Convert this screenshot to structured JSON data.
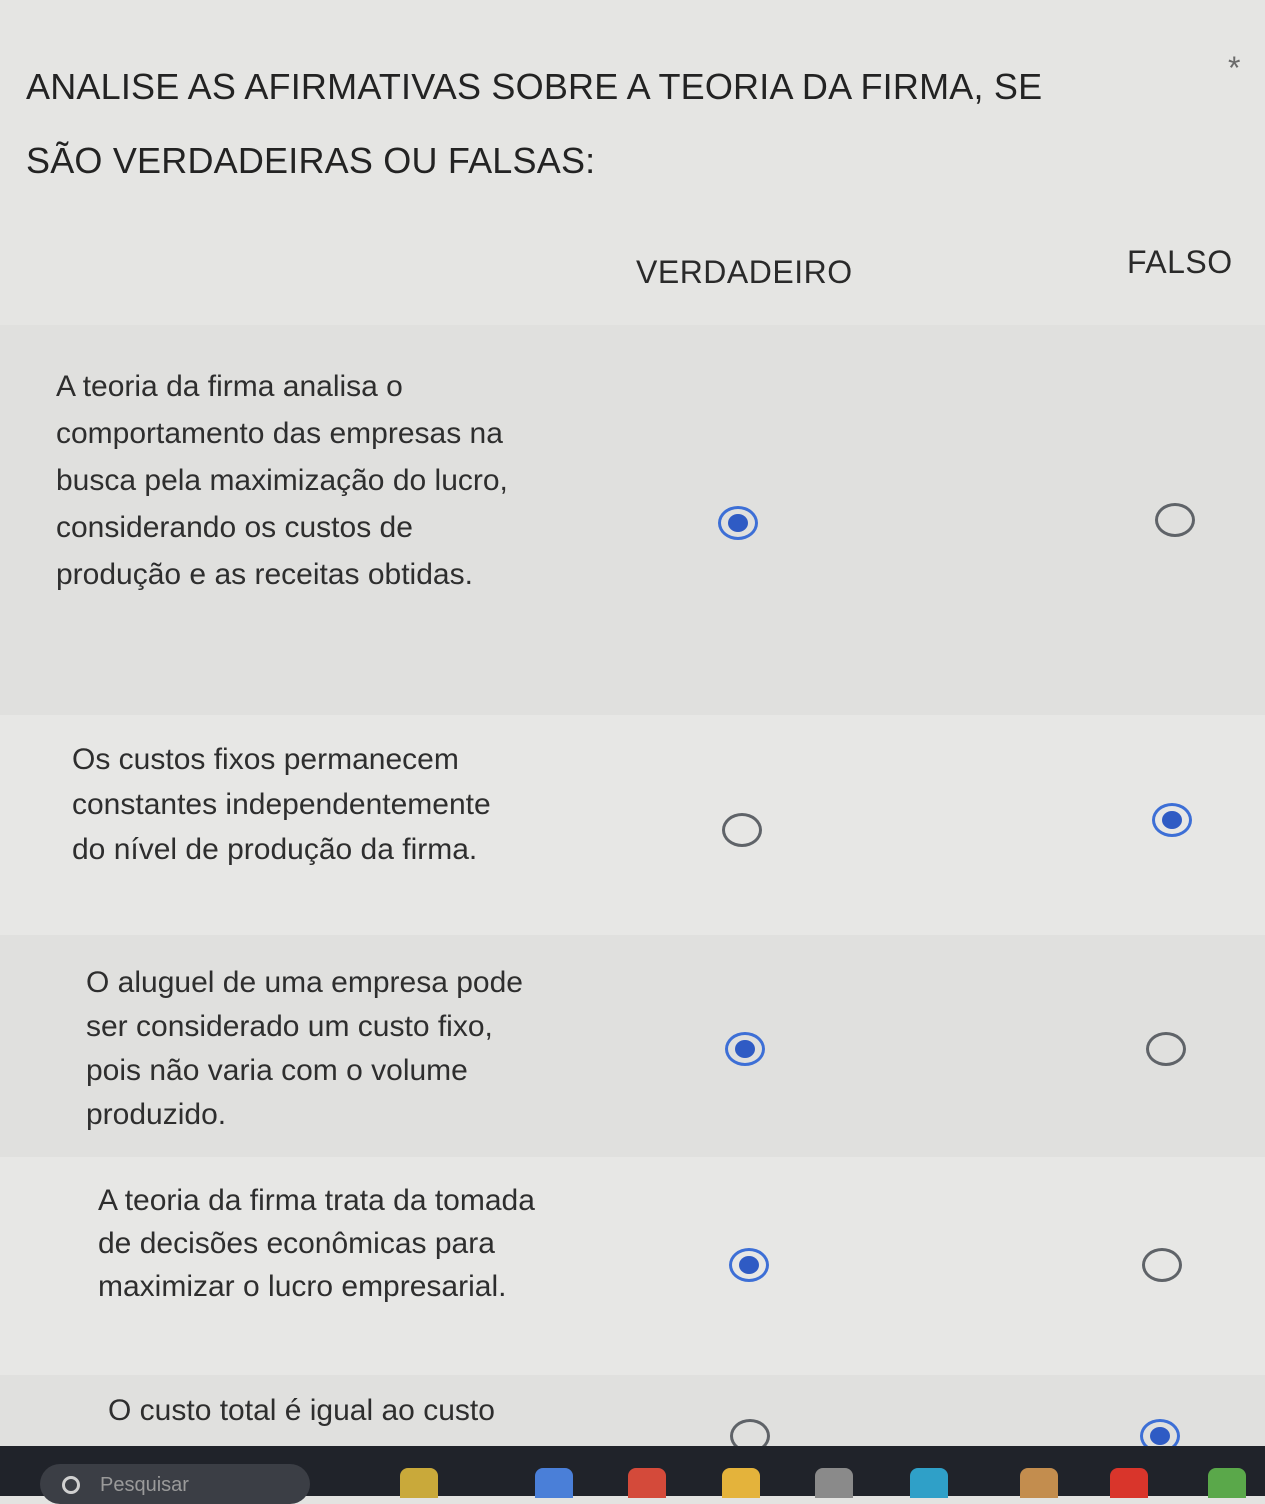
{
  "question": {
    "title": "ANALISE AS AFIRMATIVAS SOBRE A TEORIA DA FIRMA, SE SÃO VERDADEIRAS OU FALSAS:",
    "required_marker": "*"
  },
  "columns": [
    "VERDADEIRO",
    "FALSO"
  ],
  "rows": [
    {
      "label": "A teoria da firma analisa o comportamento das empresas na busca pela maximização do lucro, considerando os custos de produção e as receitas obtidas.",
      "selected": "VERDADEIRO"
    },
    {
      "label": "Os custos fixos permanecem constantes independentemente do nível de produção da firma.",
      "selected": "FALSO"
    },
    {
      "label": "O aluguel de uma empresa pode ser considerado um custo fixo, pois não varia com o volume produzido.",
      "selected": "VERDADEIRO"
    },
    {
      "label": "A teoria da firma trata da tomada de decisões econômicas para maximizar o lucro empresarial.",
      "selected": "VERDADEIRO"
    },
    {
      "label": "O custo total é igual ao custo",
      "selected": "FALSO"
    }
  ],
  "taskbar": {
    "search_placeholder": "Pesquisar",
    "icons": [
      {
        "name": "widgets-icon",
        "color": "#c9a93a"
      },
      {
        "name": "copilot-icon",
        "color": "#4a7fd8"
      },
      {
        "name": "chrome-icon",
        "color": "#d44a3a"
      },
      {
        "name": "file-explorer-icon",
        "color": "#e4b33b"
      },
      {
        "name": "app-icon",
        "color": "#8a8a8a"
      },
      {
        "name": "edge-icon",
        "color": "#2fa0c8"
      },
      {
        "name": "profile-icon",
        "color": "#c38d4e"
      },
      {
        "name": "youtube-icon",
        "color": "#d9352b"
      },
      {
        "name": "game-icon",
        "color": "#5aa84a"
      }
    ]
  },
  "colors": {
    "accent": "#2f5bc4",
    "background": "#e5e5e3",
    "taskbar": "#20232a"
  }
}
